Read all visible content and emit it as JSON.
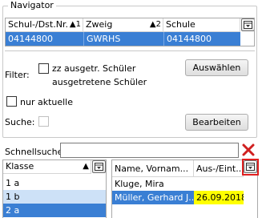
{
  "navigator": {
    "title": "Navigator",
    "columns": [
      "Schul-/Dst.Nr.",
      "Zweig",
      "Schule"
    ],
    "sort_marks": [
      "1",
      "2"
    ],
    "row": [
      "04144800",
      "GWRHS",
      "04144800"
    ]
  },
  "filter": {
    "label": "Filter:",
    "cb1_line1": "zz ausgetr. Schüler",
    "cb1_line2": "ausgetretene Schüler",
    "select_button": "Auswählen",
    "cb2_label": "nur aktuelle"
  },
  "search": {
    "label": "Suche:",
    "edit_button": "Bearbeiten"
  },
  "quicksearch": {
    "label": "Schnellsuche",
    "value": ""
  },
  "class_grid": {
    "header": "Klasse",
    "rows": [
      "1 a",
      "1 b",
      "2 a"
    ]
  },
  "student_grid": {
    "columns": [
      "Name, Vornam...",
      "Aus-/Eint..."
    ],
    "rows": [
      {
        "name": "Kluge, Mira",
        "date": ""
      },
      {
        "name": "Müller, Gerhard J...",
        "date": "26.09.2018"
      }
    ]
  },
  "icons": {
    "column_picker": "column-picker-icon",
    "clear": "clear-x-icon",
    "sort_up": "sort-up-arrow-icon"
  },
  "colors": {
    "selection": "#3a7fd4",
    "light_selection": "#cde1f7",
    "highlight": "#ffff00",
    "red_mark": "#e02020"
  }
}
